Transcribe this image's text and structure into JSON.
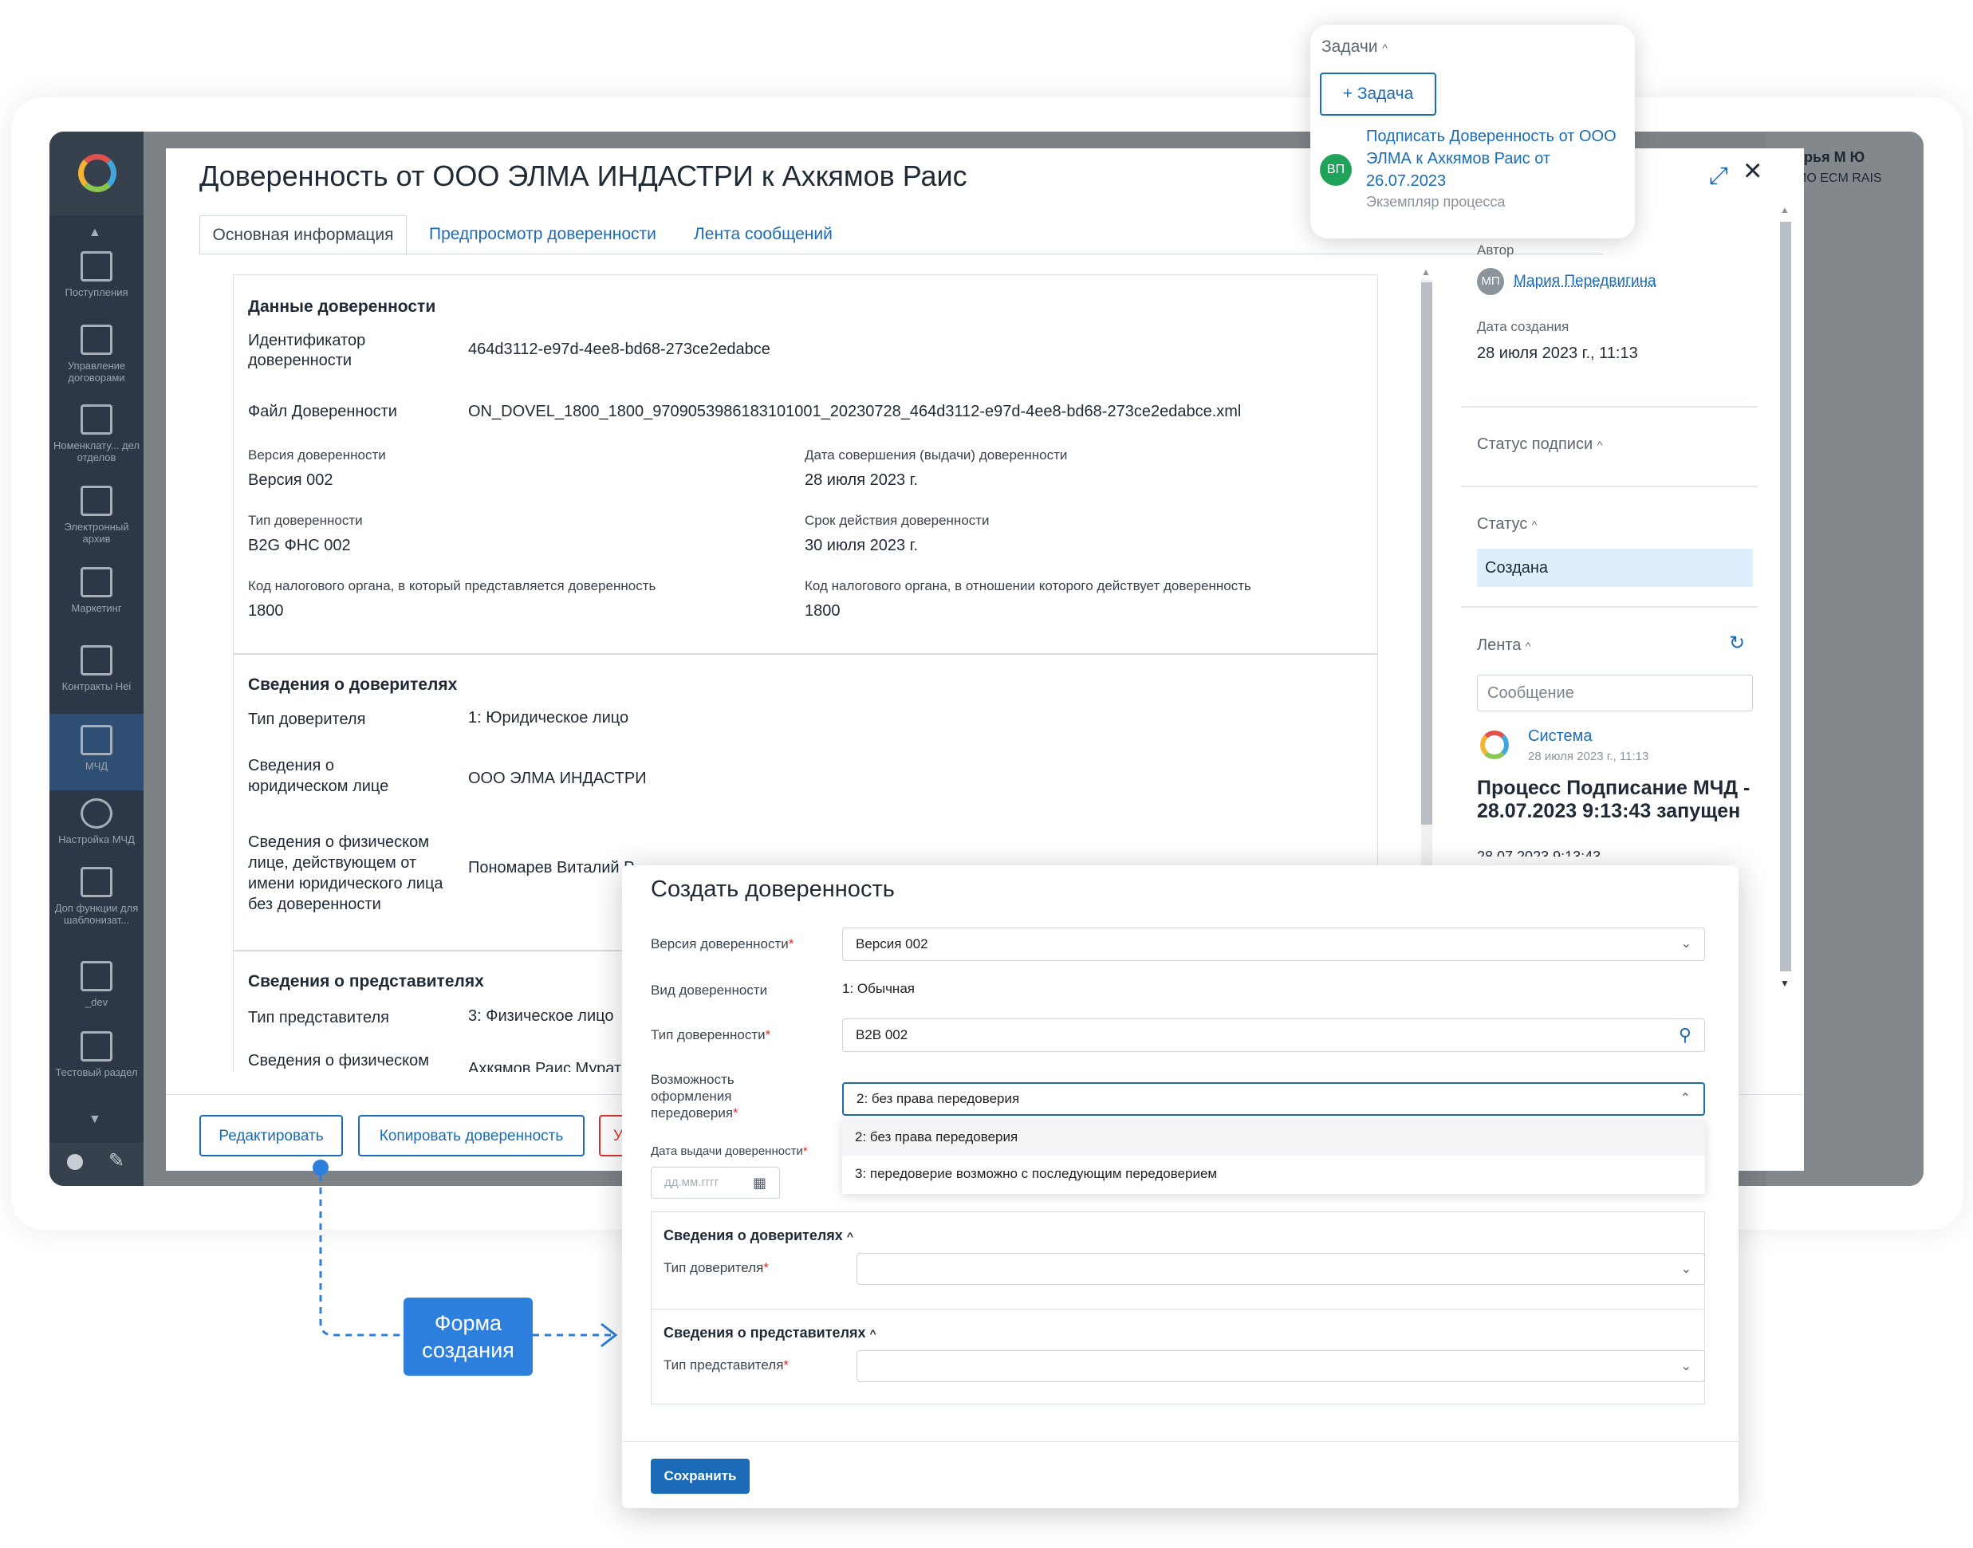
{
  "colors": {
    "accent": "#1b6bb8",
    "danger": "#d8342c",
    "sidebar": "#2c3847",
    "status_bg": "#ddeefc",
    "callout": "#2c7fdd",
    "avatar_green": "#1fa35b"
  },
  "background_app": {
    "user_name": "арья М Ю",
    "user_org": "МО ECM RAIS",
    "sidebar": [
      {
        "label": "Поступления",
        "icon": "archive-box-icon"
      },
      {
        "label": "Управление договорами",
        "icon": "briefcase-icon"
      },
      {
        "label": "Номенклату... дел отделов",
        "icon": "books-icon"
      },
      {
        "label": "Электронный архив",
        "icon": "server-icon"
      },
      {
        "label": "Маркетинг",
        "icon": "chart-icon"
      },
      {
        "label": "Контракты Hei",
        "icon": "archive-box-icon"
      },
      {
        "label": "МЧД",
        "icon": "archive-box-icon"
      },
      {
        "label": "Настройка МЧД",
        "icon": "gear-icon"
      },
      {
        "label": "Доп функции для шаблонизат...",
        "icon": "archive-box-icon"
      },
      {
        "label": "_dev",
        "icon": "archive-box-icon"
      },
      {
        "label": "Тестовый раздел",
        "icon": "archive-box-icon"
      }
    ]
  },
  "document": {
    "title": "Доверенность от ООО ЭЛМА ИНДАСТРИ к Ахкямов Раис",
    "tabs": [
      "Основная информация",
      "Предпросмотр доверенности",
      "Лента сообщений"
    ],
    "sections": {
      "poa_data": {
        "title": "Данные доверенности",
        "identifier_label": "Идентификатор доверенности",
        "identifier_value": "464d3112-e97d-4ee8-bd68-273ce2edabce",
        "file_label": "Файл Доверенности",
        "file_value": "ON_DOVEL_1800_1800_9709053986183101001_20230728_464d3112-e97d-4ee8-bd68-273ce2edabce.xml",
        "version_label": "Версия доверенности",
        "version_value": "Версия 002",
        "issue_date_label": "Дата совершения (выдачи) доверенности",
        "issue_date_value": "28 июля 2023 г.",
        "type_label": "Тип доверенности",
        "type_value": "B2G ФНС 002",
        "validity_label": "Срок действия доверенности",
        "validity_value": "30 июля 2023 г.",
        "tax_code_label": "Код налогового органа, в который представляется доверенность",
        "tax_code_value": "1800",
        "tax_code2_label": "Код налогового органа, в отношении которого действует доверенность",
        "tax_code2_value": "1800"
      },
      "principals": {
        "title": "Сведения о доверителях",
        "type_label": "Тип доверителя",
        "type_value": "1: Юридическое лицо",
        "legal_label": "Сведения о юридическом лице",
        "legal_value": "ООО ЭЛМА ИНДАСТРИ",
        "person_label": "Сведения о физическом лице, действующем от имени юридического лица без доверенности",
        "person_value": "Пономарев Виталий Р"
      },
      "representatives": {
        "title": "Сведения о представителях",
        "type_label": "Тип представителя",
        "type_value": "3: Физическое лицо",
        "person_label": "Сведения о физическом",
        "person_value": "Ахкямов Раис Мурат"
      }
    },
    "buttons": {
      "edit": "Редактировать",
      "copy": "Копировать доверенность",
      "delete_fragment": "У"
    }
  },
  "info_panel": {
    "author_label": "Автор",
    "author_initials": "МП",
    "author_name": "Мария Передвигина",
    "created_label": "Дата создания",
    "created_value": "28 июля 2023 г., 11:13",
    "sign_status_label": "Статус подписи",
    "status_label": "Статус",
    "status_value": "Создана",
    "feed_label": "Лента",
    "message_placeholder": "Сообщение",
    "feed_author": "Система",
    "feed_time": "28 июля 2023 г., 11:13",
    "feed_text": "Процесс Подписание МЧД - 28.07.2023 9:13:43 запущен",
    "feed_next_fragment": "28.07.2023 9:13:43"
  },
  "tasks": {
    "title": "Задачи",
    "add_button": "+ Задача",
    "avatar": "ВП",
    "task_title": "Подписать Доверенность от ООО ЭЛМА к Ахкямов Раис от 26.07.2023",
    "task_sub": "Экземпляр процесса"
  },
  "create_form": {
    "title": "Создать доверенность",
    "version_label": "Версия доверенности",
    "version_value": "Версия 002",
    "kind_label": "Вид доверенности",
    "kind_value": "1: Обычная",
    "type_label": "Тип доверенности",
    "type_value": "B2B 002",
    "redelegation_label": "Возможность оформления передоверия",
    "redelegation_value": "2: без права передоверия",
    "options": [
      "2: без права передоверия",
      "3: передоверие возможно с последующим передоверием"
    ],
    "issue_date_label": "Дата выдачи доверенности",
    "date_placeholder": "дд.мм.гггг",
    "principals_title": "Сведения о доверителях",
    "principal_type_label": "Тип доверителя",
    "representatives_title": "Сведения о представителях",
    "representative_type_label": "Тип представителя",
    "save_button": "Сохранить"
  },
  "callout": {
    "text": "Форма создания"
  }
}
